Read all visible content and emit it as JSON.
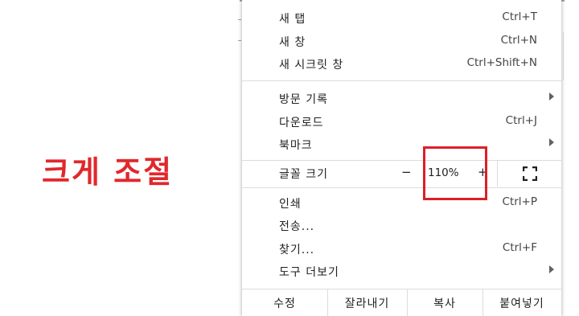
{
  "annotation": {
    "text": "크게 조절",
    "color": "#e0282c"
  },
  "menu": {
    "groups": [
      [
        {
          "label": "새 탭",
          "shortcut": "Ctrl+T"
        },
        {
          "label": "새 창",
          "shortcut": "Ctrl+N"
        },
        {
          "label": "새 시크릿 창",
          "shortcut": "Ctrl+Shift+N"
        }
      ],
      [
        {
          "label": "방문 기록",
          "submenu": true
        },
        {
          "label": "다운로드",
          "shortcut": "Ctrl+J"
        },
        {
          "label": "북마크",
          "submenu": true
        }
      ]
    ],
    "zoom": {
      "label": "글꼴 크기",
      "minus": "−",
      "value": "110%",
      "plus": "+",
      "fullscreen_icon": "fullscreen-icon"
    },
    "group3": [
      {
        "label": "인쇄",
        "shortcut": "Ctrl+P"
      },
      {
        "label": "전송..."
      },
      {
        "label": "찾기...",
        "shortcut": "Ctrl+F"
      },
      {
        "label": "도구 더보기",
        "submenu": true
      }
    ],
    "edit": {
      "edit": "수정",
      "cut": "잘라내기",
      "copy": "복사",
      "paste": "붙여넣기"
    }
  },
  "highlight_color": "#dd1f26"
}
